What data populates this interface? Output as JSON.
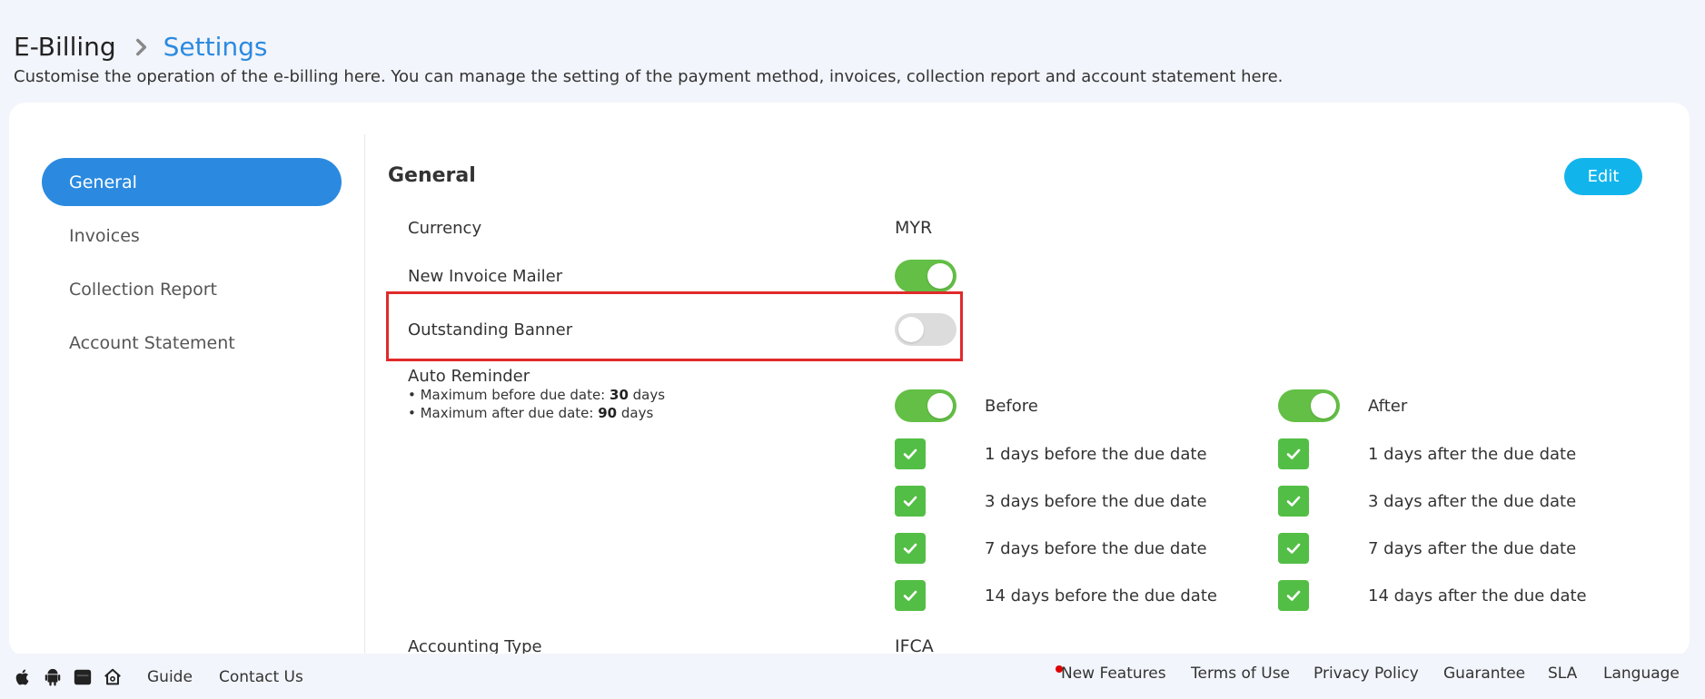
{
  "header": {
    "breadcrumb_root": "E-Billing",
    "breadcrumb_current": "Settings",
    "subtitle": "Customise the operation of the e-billing here. You can manage the setting of the payment method, invoices, collection report and account statement here."
  },
  "sidebar": {
    "items": [
      {
        "label": "General",
        "active": true
      },
      {
        "label": "Invoices",
        "active": false
      },
      {
        "label": "Collection Report",
        "active": false
      },
      {
        "label": "Account Statement",
        "active": false
      }
    ]
  },
  "general": {
    "title": "General",
    "edit_label": "Edit",
    "currency_label": "Currency",
    "currency_value": "MYR",
    "new_invoice_mailer_label": "New Invoice Mailer",
    "new_invoice_mailer_on": true,
    "outstanding_banner_label": "Outstanding Banner",
    "outstanding_banner_on": false,
    "auto_reminder": {
      "label": "Auto Reminder",
      "note_before_prefix": "• Maximum before due date: ",
      "note_before_value": "30",
      "note_before_suffix": " days",
      "note_after_prefix": "• Maximum after due date: ",
      "note_after_value": "90",
      "note_after_suffix": " days",
      "before_label": "Before",
      "before_on": true,
      "after_label": "After",
      "after_on": true,
      "before_options": [
        "1 days before the due date",
        "3 days before the due date",
        "7 days before the due date",
        "14 days before the due date"
      ],
      "after_options": [
        "1 days after the due date",
        "3 days after the due date",
        "7 days after the due date",
        "14 days after the due date"
      ]
    },
    "accounting_type_label": "Accounting Type",
    "accounting_type_value": "IFCA"
  },
  "footer": {
    "icons": [
      "apple-icon",
      "android-icon",
      "app-icon",
      "home-icon"
    ],
    "links": [
      "Guide",
      "Contact Us"
    ],
    "right_links": [
      "New Features",
      "Terms of Use",
      "Privacy Policy",
      "Guarantee",
      "SLA",
      "Language"
    ]
  },
  "colors": {
    "accent": "#2b8ae0",
    "edit_button": "#12b4ec",
    "toggle_on": "#63bf45",
    "checkbox": "#53be45",
    "highlight": "#e02a2a"
  }
}
